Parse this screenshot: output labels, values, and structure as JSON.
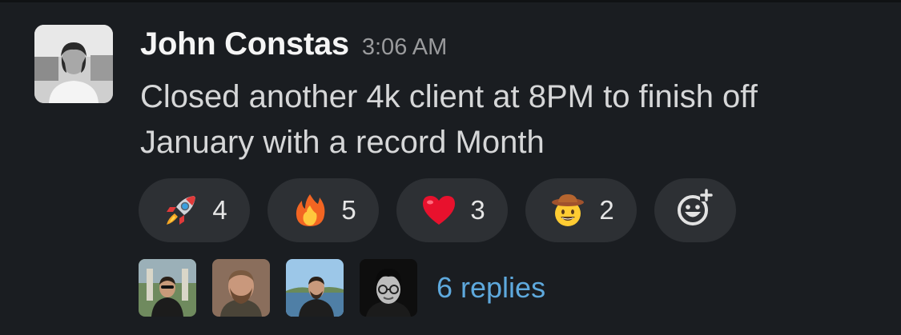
{
  "message": {
    "sender": "John Constas",
    "timestamp": "3:06 AM",
    "text": "Closed another 4k client at 8PM to finish off January with a record Month",
    "avatar_icon": "user-avatar-photo"
  },
  "reactions": [
    {
      "emoji": "rocket",
      "count": "4"
    },
    {
      "emoji": "fire",
      "count": "5"
    },
    {
      "emoji": "red-heart",
      "count": "3"
    },
    {
      "emoji": "cowboy-hat-face",
      "count": "2"
    }
  ],
  "add_reaction": {
    "icon": "add-reaction-icon"
  },
  "thread": {
    "participants": [
      "participant-1",
      "participant-2",
      "participant-3",
      "participant-4"
    ],
    "replies_label": "6 replies"
  },
  "colors": {
    "background": "#1a1d21",
    "pill": "#2d3034",
    "link": "#5ea9dd"
  }
}
